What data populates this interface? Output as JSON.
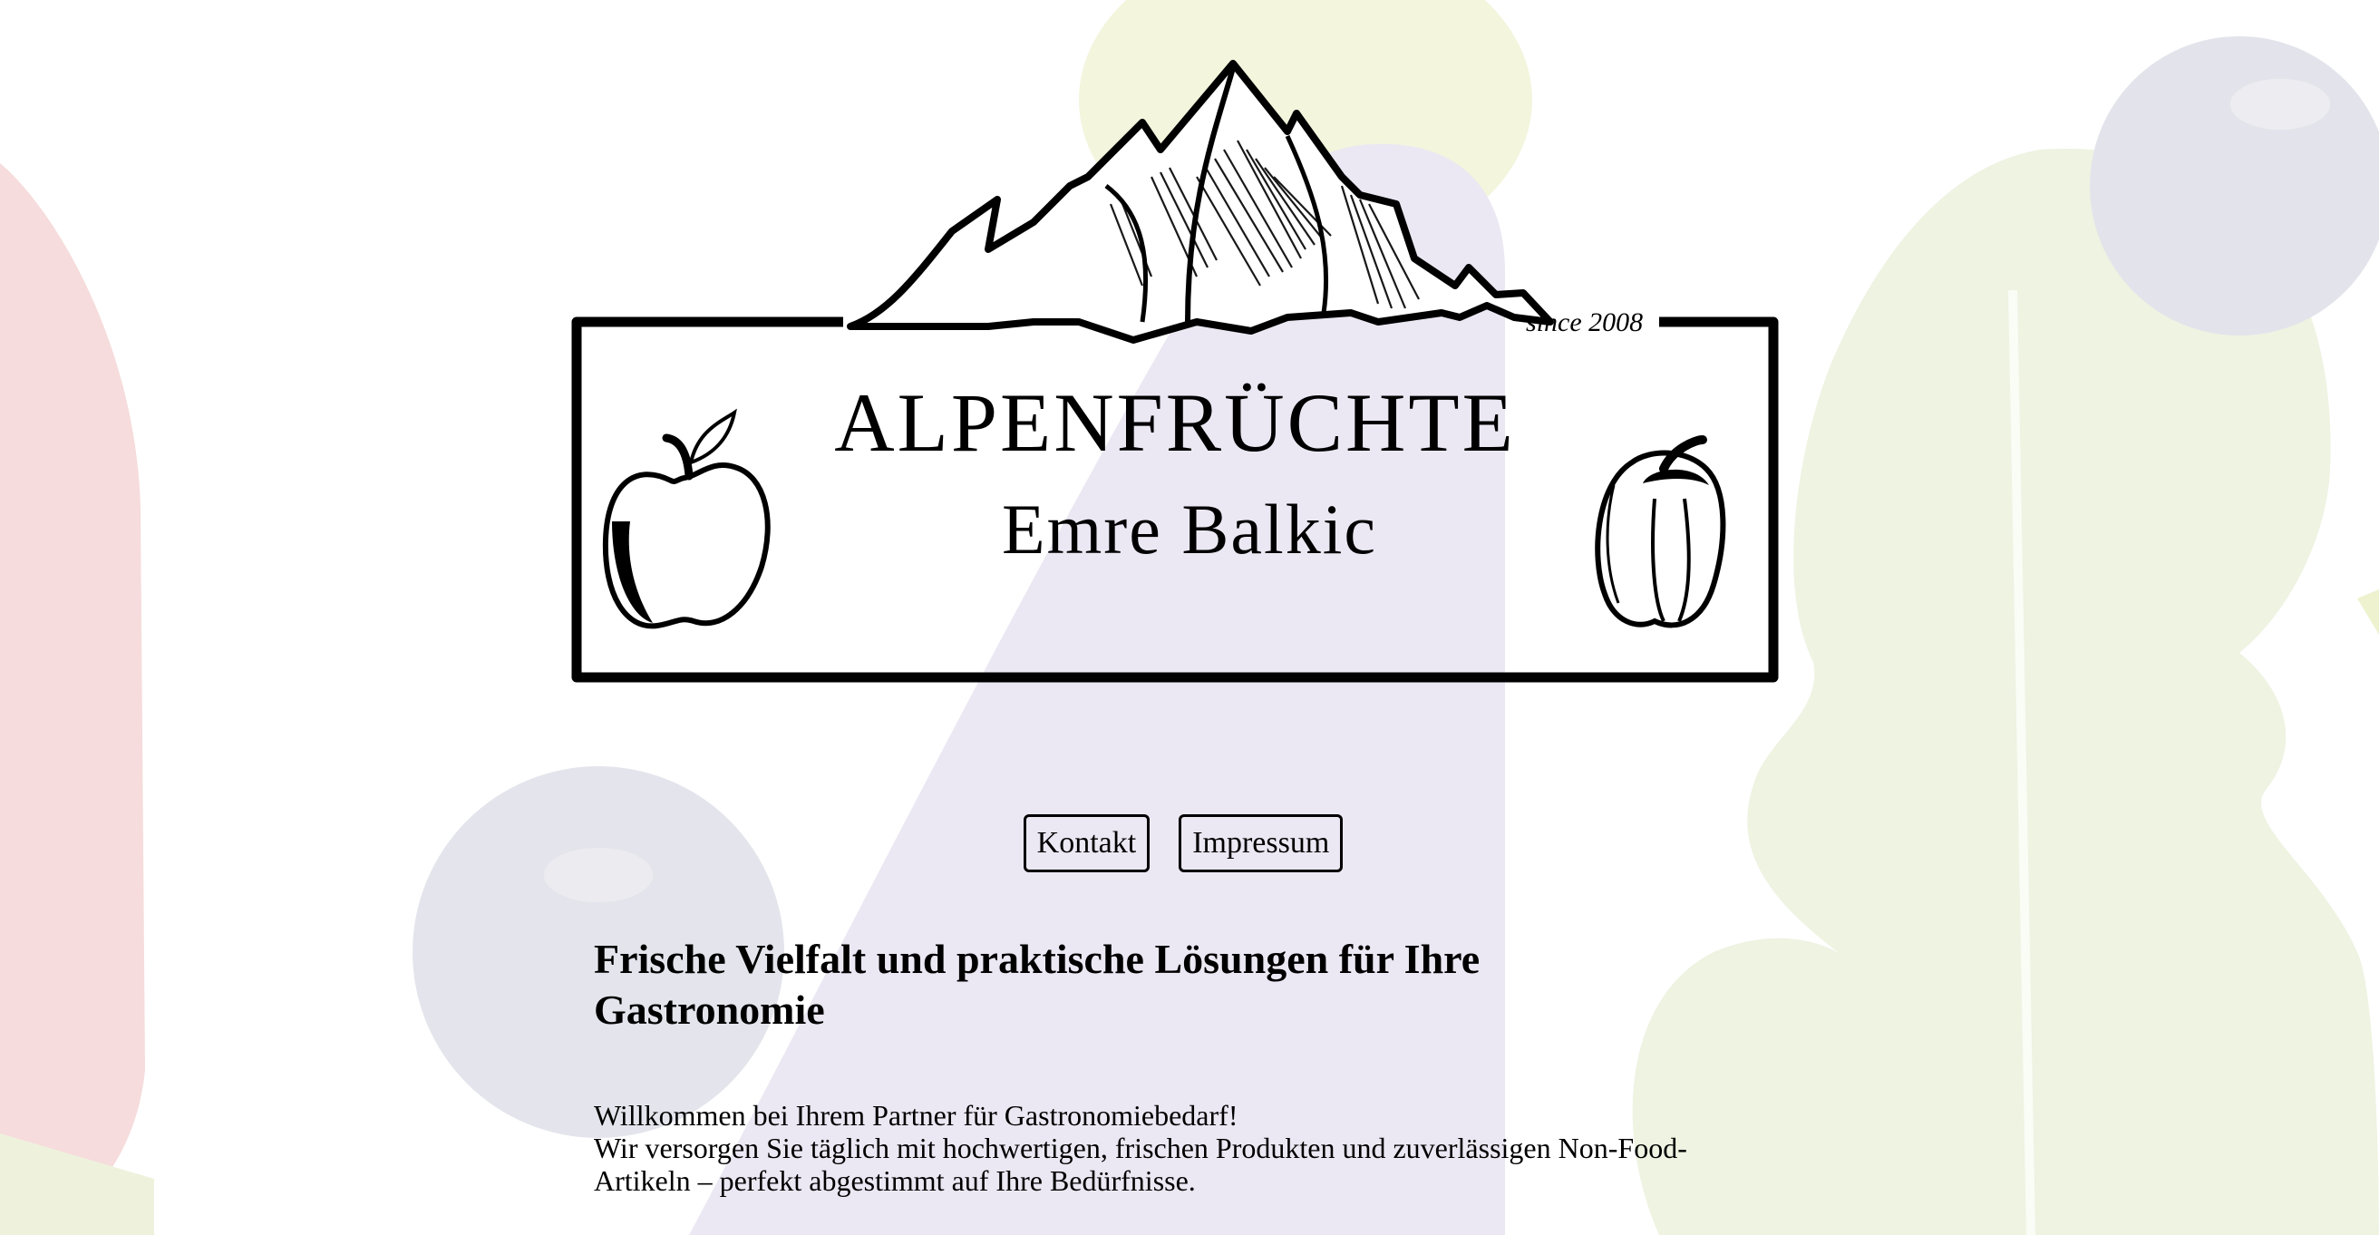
{
  "brand": {
    "name": "ALPENFRÜCHTE",
    "owner": "Emre Balkic",
    "since": "since 2008"
  },
  "nav": {
    "items": [
      {
        "label": "Kontakt"
      },
      {
        "label": "Impressum"
      }
    ]
  },
  "main": {
    "headline": "Frische Vielfalt und praktische Lösungen für Ihre Gastronomie",
    "intro_line1": "Willkommen bei Ihrem Partner für Gastronomiebedarf!",
    "intro_line2": "Wir versorgen Sie täglich mit hochwertigen, frischen Produkten und zuverlässigen Non-Food-Artikeln – perfekt abgestimmt auf Ihre Bedürfnisse."
  },
  "colors": {
    "background": "#ffffff",
    "bg_lavender": "#e9e6f2",
    "bg_green": "#eef3df",
    "bg_yellow": "#f3f4dc",
    "bg_red": "#f6dada",
    "bg_gray": "#e2e3ea",
    "ink": "#000000"
  },
  "icons": {
    "logo_left": "apple-icon",
    "logo_right": "pepper-icon",
    "logo_top": "mountain-icon"
  }
}
